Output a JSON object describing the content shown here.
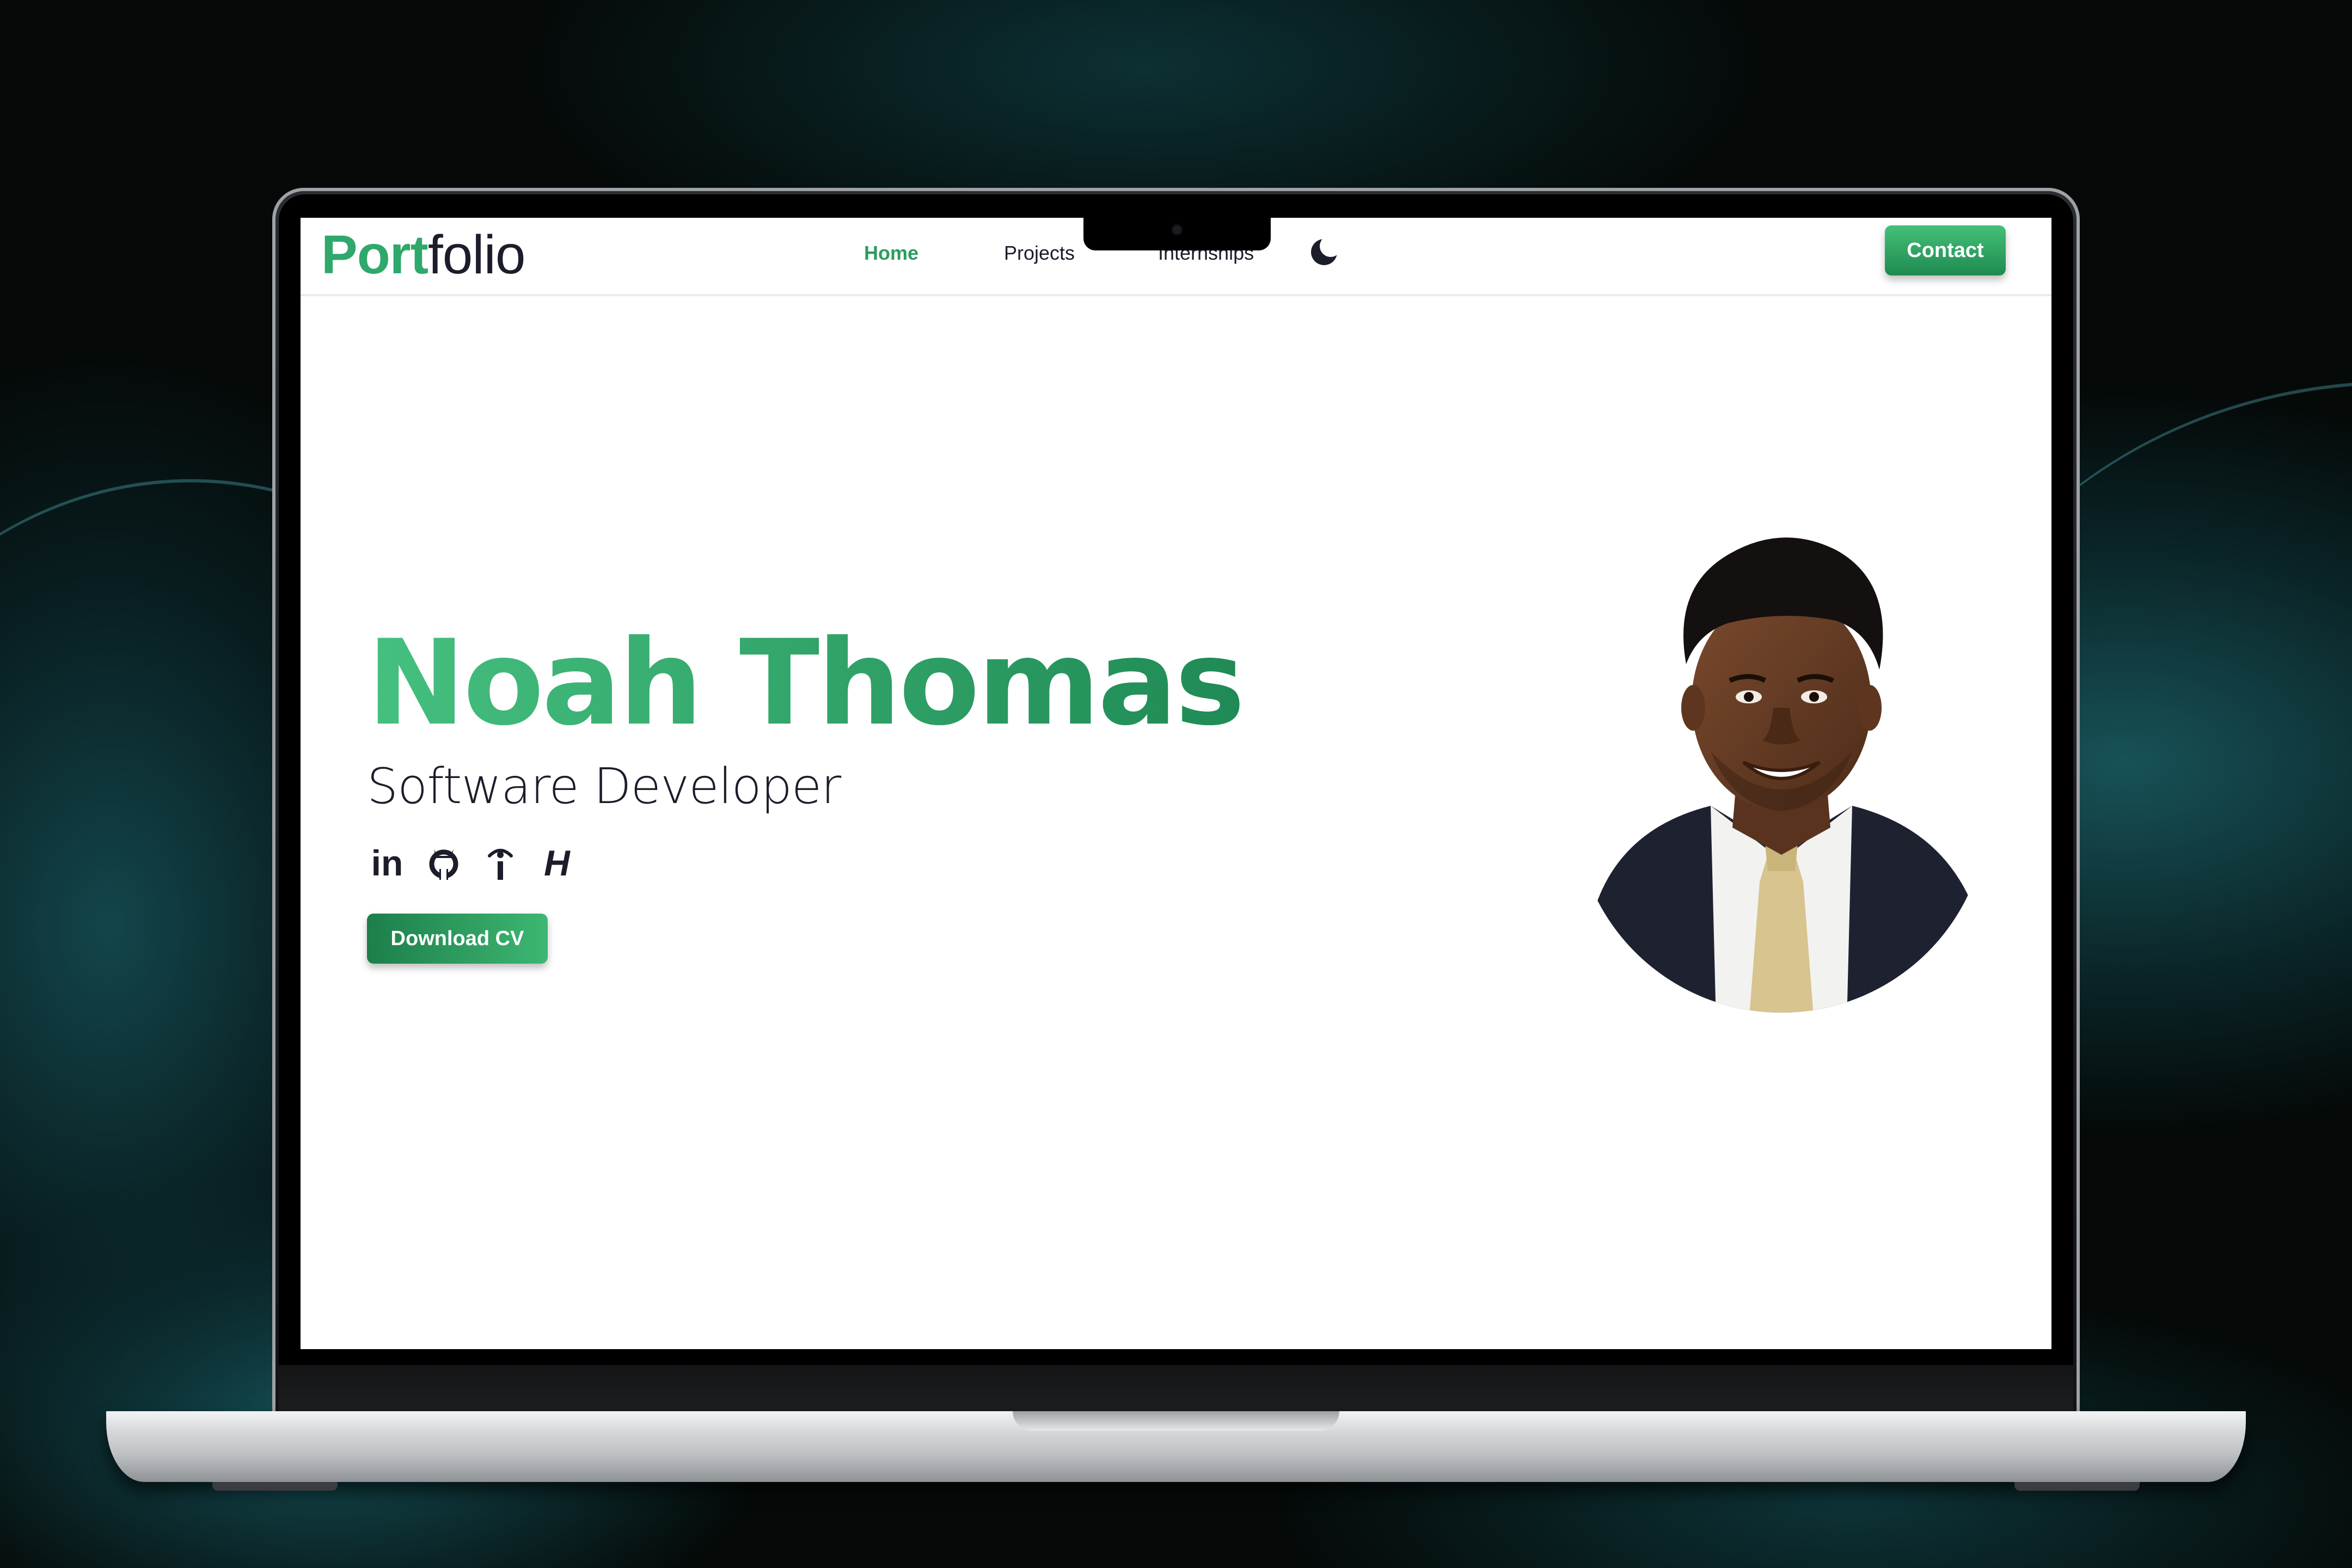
{
  "nav": {
    "logo_accent": "Port",
    "logo_rest": "folio",
    "links": [
      "Home",
      "Projects",
      "Internships"
    ],
    "active_link": "Home",
    "contact_label": "Contact",
    "theme_icon": "moon-icon"
  },
  "hero": {
    "name": "Noah Thomas",
    "role": "Software Developer",
    "socials": [
      {
        "icon": "linkedin-icon",
        "label": "in"
      },
      {
        "icon": "github-icon"
      },
      {
        "icon": "info-icon"
      },
      {
        "icon": "hashnode-icon",
        "label": "H"
      }
    ],
    "download_label": "Download CV"
  },
  "colors": {
    "accent": "#2fa86b",
    "accent_dark": "#1f8a4f",
    "text": "#1b1d2a"
  }
}
